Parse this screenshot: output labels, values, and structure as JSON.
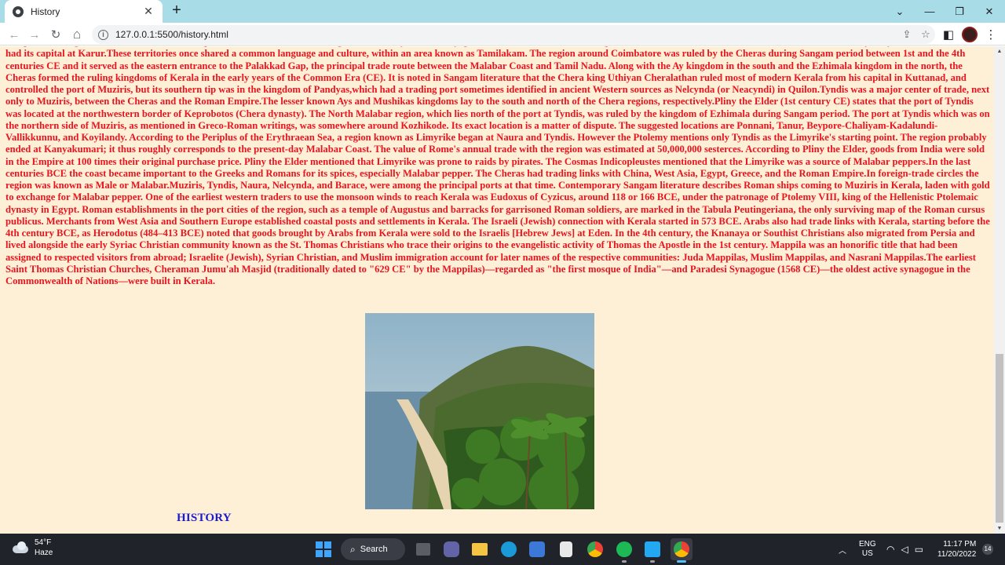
{
  "browser": {
    "tab_title": "History",
    "tab_close": "✕",
    "new_tab": "+",
    "url": "127.0.0.1:5500/history.html",
    "info_glyph": "i",
    "back_glyph": "←",
    "forward_glyph": "→",
    "reload_glyph": "↻",
    "home_glyph": "⌂",
    "share_glyph": "⇪",
    "star_glyph": "☆",
    "sidepanel_glyph": "◧",
    "menu_glyph": "⋮",
    "minimize_glyph": "—",
    "maximize_glyph": "❐",
    "close_glyph": "✕",
    "tablist_glyph": "⌄"
  },
  "page": {
    "body_text": "independent kingdoms in southern India during Ashoka's time, the others being Cholas, Pandyas, and Satiyaputras. Scholars hold that Keralaputra is an alternate name of the Cheras, the first dominant dynasty who ruled Kerala, and had its capital at Karur.These territories once shared a common language and culture, within an area known as Tamilakam. The region around Coimbatore was ruled by the Cheras during Sangam period between 1st and the 4th centuries CE and it served as the eastern entrance to the Palakkad Gap, the principal trade route between the Malabar Coast and Tamil Nadu. Along with the Ay kingdom in the south and the Ezhimala kingdom in the north, the Cheras formed the ruling kingdoms of Kerala in the early years of the Common Era (CE). It is noted in Sangam literature that the Chera king Uthiyan Cheralathan ruled most of modern Kerala from his capital in Kuttanad, and controlled the port of Muziris, but its southern tip was in the kingdom of Pandyas,which had a trading port sometimes identified in ancient Western sources as Nelcynda (or Neacyndi) in Quilon.Tyndis was a major center of trade, next only to Muziris, between the Cheras and the Roman Empire.The lesser known Ays and Mushikas kingdoms lay to the south and north of the Chera regions, respectively.Pliny the Elder (1st century CE) states that the port of Tyndis was located at the northwestern border of Keprobotos (Chera dynasty). The North Malabar region, which lies north of the port at Tyndis, was ruled by the kingdom of Ezhimala during Sangam period. The port at Tyndis which was on the northern side of Muziris, as mentioned in Greco-Roman writings, was somewhere around Kozhikode. Its exact location is a matter of dispute. The suggested locations are Ponnani, Tanur, Beypore-Chaliyam-Kadalundi-Vallikkunnu, and Koyilandy. According to the Periplus of the Erythraean Sea, a region known as Limyrike began at Naura and Tyndis. However the Ptolemy mentions only Tyndis as the Limyrike's starting point. The region probably ended at Kanyakumari; it thus roughly corresponds to the present-day Malabar Coast. The value of Rome's annual trade with the region was estimated at 50,000,000 sesterces. According to Pliny the Elder, goods from India were sold in the Empire at 100 times their original purchase price. Pliny the Elder mentioned that Limyrike was prone to raids by pirates. The Cosmas Indicopleustes mentioned that the Limyrike was a source of Malabar peppers.In the last centuries BCE the coast became important to the Greeks and Romans for its spices, especially Malabar pepper. The Cheras had trading links with China, West Asia, Egypt, Greece, and the Roman Empire.In foreign-trade circles the region was known as Male or Malabar.Muziris, Tyndis, Naura, Nelcynda, and Barace, were among the principal ports at that time. Contemporary Sangam literature describes Roman ships coming to Muziris in Kerala, laden with gold to exchange for Malabar pepper. One of the earliest western traders to use the monsoon winds to reach Kerala was Eudoxus of Cyzicus, around 118 or 166 BCE, under the patronage of Ptolemy VIII, king of the Hellenistic Ptolemaic dynasty in Egypt. Roman establishments in the port cities of the region, such as a temple of Augustus and barracks for garrisoned Roman soldiers, are marked in the Tabula Peutingeriana, the only surviving map of the Roman cursus publicus. Merchants from West Asia and Southern Europe established coastal posts and settlements in Kerala. The Israeli (Jewish) connection with Kerala started in 573 BCE. Arabs also had trade links with Kerala, starting before the 4th century BCE, as Herodotus (484–413 BCE) noted that goods brought by Arabs from Kerala were sold to the Israelis [Hebrew Jews] at Eden. In the 4th century, the Knanaya or Southist Christians also migrated from Persia and lived alongside the early Syriac Christian community known as the St. Thomas Christians who trace their origins to the evangelistic activity of Thomas the Apostle in the 1st century. Mappila was an honorific title that had been assigned to respected visitors from abroad; Israelite (Jewish), Syrian Christian, and Muslim immigration account for later names of the respective communities: Juda Mappilas, Muslim Mappilas, and Nasrani Mappilas.The earliest Saint Thomas Christian Churches, Cheraman Jumu'ah Masjid (traditionally dated to \"629 CE\" by the Mappilas)—regarded as \"the first mosque of India\"—and Paradesi Synagogue (1568 CE)—the oldest active synagogue in the Commonwealth of Nations—were built in Kerala.",
    "heading": "HISTORY",
    "text_color": "#e8141f",
    "heading_color": "#1c1ccc",
    "background": "#fef0d7"
  },
  "taskbar": {
    "weather_temp": "54°F",
    "weather_desc": "Haze",
    "search_label": "Search",
    "search_glyph": "⌕",
    "lang_line1": "ENG",
    "lang_line2": "US",
    "time": "11:17 PM",
    "date": "11/20/2022",
    "notification_count": "14",
    "chevron_glyph": "︿",
    "wifi_glyph": "◠",
    "volume_glyph": "◁",
    "battery_glyph": "▭"
  }
}
